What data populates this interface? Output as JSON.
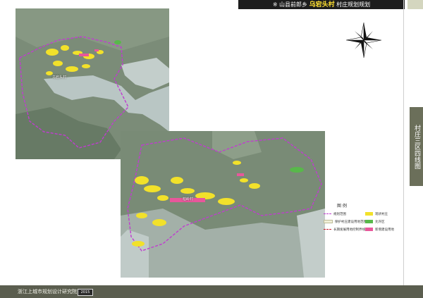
{
  "header": {
    "prefix": "※ 山县前郎乡",
    "highlight": "乌宕头村",
    "suffix": "村庄规划规划"
  },
  "side_tab": {
    "label": "村庄三区四线图"
  },
  "footer": {
    "text": "浙江上城市规划设计研究院",
    "badge": "2015"
  },
  "legend": {
    "title": "图 例",
    "items": [
      {
        "label": "规划范围",
        "color": "#c03cd0"
      },
      {
        "label": "现状村庄",
        "color": "#f2e12a"
      },
      {
        "label": "保护村庄建设用地范围",
        "color": "#f0efd8"
      },
      {
        "label": "允许区",
        "color": "#58b84a"
      },
      {
        "label": "长期发展用地控制界线",
        "color": "#c71f2f"
      },
      {
        "label": "新增建设用地",
        "color": "#e8579b"
      }
    ]
  },
  "maps": {
    "top_label": "乌宕头村",
    "bottom_label": "柏岭村"
  },
  "colors": {
    "imagery_land": "#788a76",
    "water": "#b9c6c4",
    "boundary": "#c03cd0",
    "settlement": "#f2e12a",
    "new_build": "#e8579b",
    "green": "#58b84a"
  }
}
